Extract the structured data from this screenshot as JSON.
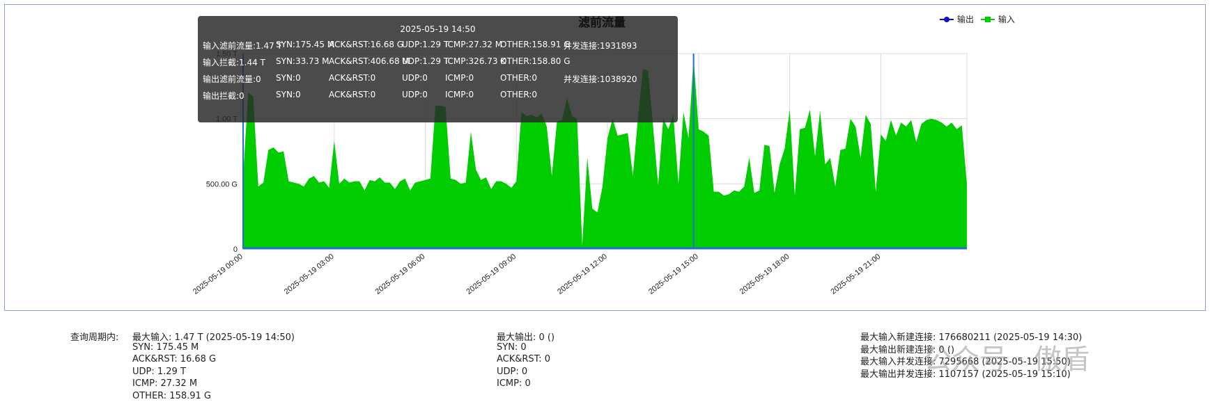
{
  "chart_data": {
    "type": "area",
    "title": "滤前流量",
    "legend": [
      {
        "name": "输出",
        "color": "#1010cc"
      },
      {
        "name": "输入",
        "color": "#00cc00"
      }
    ],
    "legend_position": "top-right",
    "y_ticks": [
      "0",
      "500.00 G",
      "1.00 T",
      "1.50 T"
    ],
    "y_tick_values_G": [
      0,
      500,
      1000,
      1500
    ],
    "ylim_G": [
      0,
      1500
    ],
    "x_ticks": [
      "2025-05-19 00:00",
      "2025-05-19 03:00",
      "2025-05-19 06:00",
      "2025-05-19 09:00",
      "2025-05-19 12:00",
      "2025-05-19 15:00",
      "2025-05-19 18:00",
      "2025-05-19 21:00"
    ],
    "x_range_minutes": [
      0,
      1430
    ],
    "grid": true,
    "hover_minute": 890,
    "series": [
      {
        "name": "输入",
        "color": "#00cc00",
        "x_minutes": [
          0,
          10,
          20,
          30,
          40,
          50,
          60,
          70,
          80,
          90,
          100,
          110,
          120,
          130,
          140,
          150,
          160,
          170,
          180,
          190,
          200,
          210,
          220,
          230,
          240,
          250,
          260,
          270,
          280,
          290,
          300,
          310,
          320,
          330,
          340,
          350,
          360,
          370,
          380,
          390,
          400,
          410,
          420,
          430,
          440,
          450,
          460,
          470,
          480,
          490,
          500,
          510,
          520,
          530,
          540,
          550,
          560,
          570,
          580,
          590,
          600,
          610,
          620,
          630,
          640,
          650,
          660,
          670,
          680,
          690,
          700,
          710,
          720,
          730,
          740,
          750,
          760,
          770,
          780,
          790,
          800,
          810,
          820,
          830,
          840,
          850,
          860,
          870,
          880,
          890,
          900,
          910,
          920,
          930,
          940,
          950,
          960,
          970,
          980,
          990,
          1000,
          1010,
          1020,
          1030,
          1040,
          1050,
          1060,
          1070,
          1080,
          1090,
          1100,
          1110,
          1120,
          1130,
          1140,
          1150,
          1160,
          1170,
          1180,
          1190,
          1200,
          1210,
          1220,
          1230,
          1240,
          1250,
          1260,
          1270,
          1280,
          1290,
          1300,
          1310,
          1320,
          1330,
          1340,
          1350,
          1360,
          1370,
          1380,
          1390,
          1400,
          1410,
          1420,
          1430
        ],
        "values_G": [
          560,
          1200,
          1170,
          480,
          510,
          760,
          780,
          740,
          750,
          520,
          510,
          500,
          480,
          540,
          560,
          510,
          520,
          470,
          830,
          500,
          540,
          510,
          520,
          520,
          450,
          530,
          520,
          550,
          510,
          510,
          460,
          520,
          540,
          450,
          510,
          520,
          530,
          540,
          1100,
          1100,
          1090,
          540,
          530,
          500,
          510,
          900,
          610,
          530,
          550,
          460,
          520,
          520,
          500,
          470,
          520,
          1050,
          1020,
          1030,
          1010,
          1040,
          940,
          560,
          980,
          990,
          1160,
          1020,
          1000,
          30,
          700,
          310,
          280,
          480,
          850,
          1000,
          870,
          880,
          890,
          560,
          1000,
          1380,
          1370,
          940,
          490,
          1000,
          920,
          1030,
          500,
          1050,
          850,
          1470,
          920,
          900,
          870,
          440,
          440,
          410,
          420,
          450,
          440,
          480,
          700,
          430,
          450,
          800,
          790,
          430,
          650,
          770,
          1070,
          410,
          920,
          930,
          1070,
          710,
          1060,
          650,
          700,
          480,
          760,
          770,
          1000,
          940,
          700,
          1030,
          960,
          440,
          880,
          830,
          990,
          870,
          970,
          940,
          990,
          820,
          960,
          990,
          1000,
          990,
          970,
          940,
          970,
          920,
          950,
          500,
          800
        ]
      },
      {
        "name": "输出",
        "color": "#1010cc",
        "x_minutes": [
          0,
          1430
        ],
        "values_G": [
          0,
          0
        ]
      }
    ]
  },
  "tooltip": {
    "time": "2025-05-19 14:50",
    "rows": [
      [
        "输入滤前流量:1.47 T",
        "SYN:175.45 M",
        "ACK&RST:16.68 G",
        "UDP:1.29 T",
        "ICMP:27.32 M",
        "OTHER:158.91 G",
        "并发连接:1931893"
      ],
      [
        "输入拦截:1.44 T",
        "SYN:33.73 M",
        "ACK&RST:406.68 M",
        "UDP:1.29 T",
        "ICMP:326.73 K",
        "OTHER:158.80 G",
        ""
      ],
      [
        "输出滤前流量:0",
        "SYN:0",
        "ACK&RST:0",
        "UDP:0",
        "ICMP:0",
        "OTHER:0",
        "并发连接:1038920"
      ],
      [
        "输出拦截:0",
        "SYN:0",
        "ACK&RST:0",
        "UDP:0",
        "ICMP:0",
        "OTHER:0",
        ""
      ]
    ]
  },
  "stats": {
    "period_label": "查询周期内:",
    "col1": [
      "最大输入: 1.47 T (2025-05-19 14:50)",
      "SYN: 175.45 M",
      "ACK&RST: 16.68 G",
      "UDP: 1.29 T",
      "ICMP: 27.32 M",
      "OTHER: 158.91 G"
    ],
    "col2": [
      "最大输出: 0 ()",
      "SYN: 0",
      "ACK&RST: 0",
      "UDP: 0",
      "ICMP: 0"
    ],
    "col3": [
      "最大输入新建连接: 176680211 (2025-05-19 14:30)",
      "最大输出新建连接: 0 ()",
      "最大输入并发连接: 7295668 (2025-05-19 15:50)",
      "最大输出并发连接: 1107157 (2025-05-19 15:10)"
    ]
  },
  "watermark": "公众号 · 傲盾"
}
